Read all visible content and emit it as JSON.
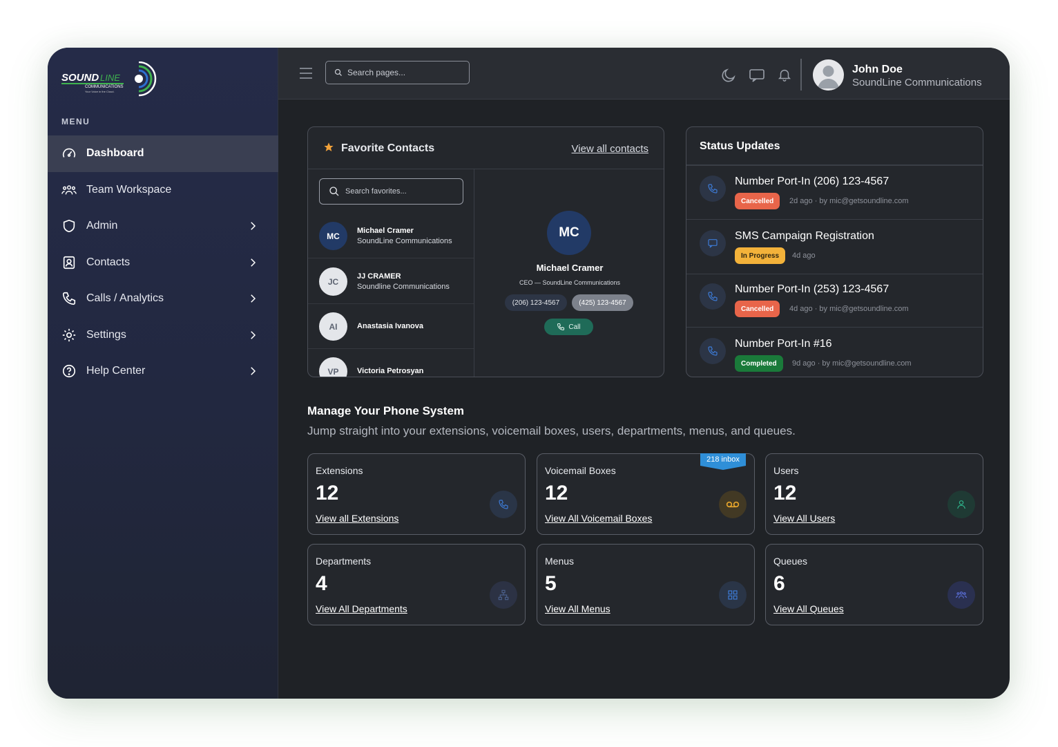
{
  "brand": {
    "logo_word_1": "SOUND",
    "logo_word_2": "LINE",
    "logo_sub": "COMMUNICATIONS",
    "logo_tagline": "Your Voice in the Cloud.",
    "accent_green": "#3fb34f",
    "accent_blue": "#2f6fd0"
  },
  "sidebar": {
    "menu_label": "MENU",
    "items": [
      {
        "label": "Dashboard",
        "icon": "gauge-icon",
        "active": true
      },
      {
        "label": "Team Workspace",
        "icon": "team-icon"
      },
      {
        "label": "Admin",
        "icon": "shield-icon",
        "chevron": true
      },
      {
        "label": "Contacts",
        "icon": "contact-card-icon",
        "chevron": true
      },
      {
        "label": "Calls / Analytics",
        "icon": "phone-icon",
        "chevron": true
      },
      {
        "label": "Settings",
        "icon": "sun-gear-icon",
        "chevron": true
      },
      {
        "label": "Help Center",
        "icon": "help-icon",
        "chevron": true
      }
    ]
  },
  "topbar": {
    "search_placeholder": "Search pages...",
    "user_name": "John Doe",
    "user_org": "SoundLine Communications"
  },
  "favorites": {
    "title": "Favorite Contacts",
    "view_all": "View all contacts",
    "search_placeholder": "Search favorites...",
    "contacts": [
      {
        "initials": "MC",
        "name": "Michael Cramer",
        "org": "SoundLine Communications",
        "style": "dark"
      },
      {
        "initials": "JC",
        "name": "JJ CRAMER",
        "org": "Soundline Communications",
        "style": "light"
      },
      {
        "initials": "AI",
        "name": "Anastasia Ivanova",
        "org": "",
        "style": "light"
      },
      {
        "initials": "VP",
        "name": "Victoria Petrosyan",
        "org": "",
        "style": "light"
      }
    ],
    "selected": {
      "initials": "MC",
      "name": "Michael Cramer",
      "title": "CEO — SoundLine Communications",
      "phone_1": "(206) 123-4567",
      "phone_2": "(425) 123-4567",
      "call_label": "Call"
    }
  },
  "status_updates": {
    "title": "Status Updates",
    "items": [
      {
        "title": "Number Port-In (206) 123-4567",
        "status": "Cancelled",
        "meta": "2d ago · by mic@getsoundline.com",
        "icon": "phone-icon"
      },
      {
        "title": "SMS Campaign Registration",
        "status": "In Progress",
        "meta": "4d ago",
        "icon": "message-icon"
      },
      {
        "title": "Number Port-In (253) 123-4567",
        "status": "Cancelled",
        "meta": "4d ago · by mic@getsoundline.com",
        "icon": "phone-icon"
      },
      {
        "title": "Number Port-In #16",
        "status": "Completed",
        "meta": "9d ago · by mic@getsoundline.com",
        "icon": "phone-icon"
      }
    ]
  },
  "manage": {
    "title": "Manage Your Phone System",
    "subtitle": "Jump straight into your extensions, voicemail boxes, users, departments, menus, and queues.",
    "tiles": [
      {
        "label": "Extensions",
        "count": "12",
        "link": "View all Extensions",
        "icon": "phone-icon",
        "icon_color": "#3d7bd6",
        "icon_bg": "#2a3547"
      },
      {
        "label": "Voicemail Boxes",
        "count": "12",
        "link": "View All Voicemail Boxes",
        "icon": "voicemail-icon",
        "icon_color": "#e6a52c",
        "icon_bg": "#423924",
        "badge": "218 inbox"
      },
      {
        "label": "Users",
        "count": "12",
        "link": "View All Users",
        "icon": "user-icon",
        "icon_color": "#2fb38a",
        "icon_bg": "#1f3a34"
      },
      {
        "label": "Departments",
        "count": "4",
        "link": "View All Departments",
        "icon": "org-chart-icon",
        "icon_color": "#4a5f8a",
        "icon_bg": "#2c3244"
      },
      {
        "label": "Menus",
        "count": "5",
        "link": "View All Menus",
        "icon": "grid-icon",
        "icon_color": "#3d7bd6",
        "icon_bg": "#2a3547"
      },
      {
        "label": "Queues",
        "count": "6",
        "link": "View All Queues",
        "icon": "group-icon",
        "icon_color": "#5a6fd8",
        "icon_bg": "#2a3050"
      }
    ]
  }
}
